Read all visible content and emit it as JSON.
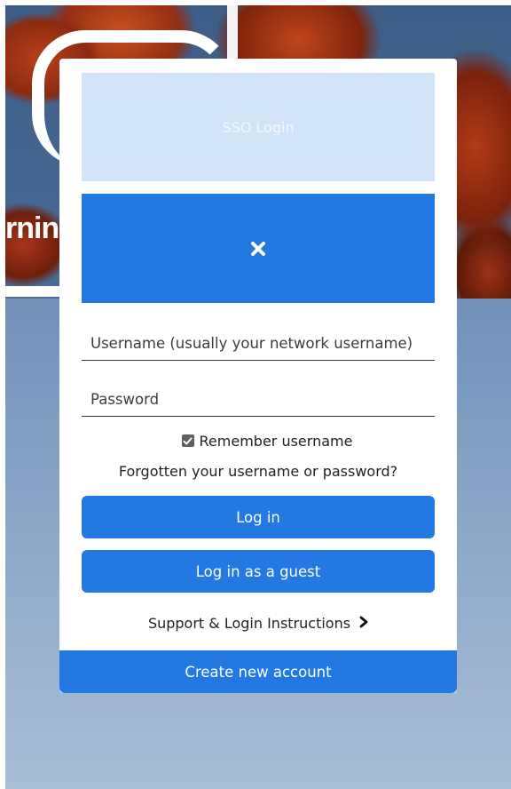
{
  "background": {
    "logo_text": "rnin"
  },
  "login": {
    "sso_label": "SSO Login",
    "close_icon": "close-icon",
    "username_placeholder": "Username (usually your network username)",
    "username_value": "",
    "password_placeholder": "Password",
    "password_value": "",
    "remember_label": "Remember username",
    "remember_checked": true,
    "forgot_label": "Forgotten your username or password?",
    "login_label": "Log in",
    "guest_label": "Log in as a guest",
    "support_label": "Support & Login Instructions",
    "support_icon": "chevron-right-icon",
    "create_label": "Create new account"
  },
  "colors": {
    "primary": "#2378e2",
    "sso_tile": "#d2e4f8"
  }
}
